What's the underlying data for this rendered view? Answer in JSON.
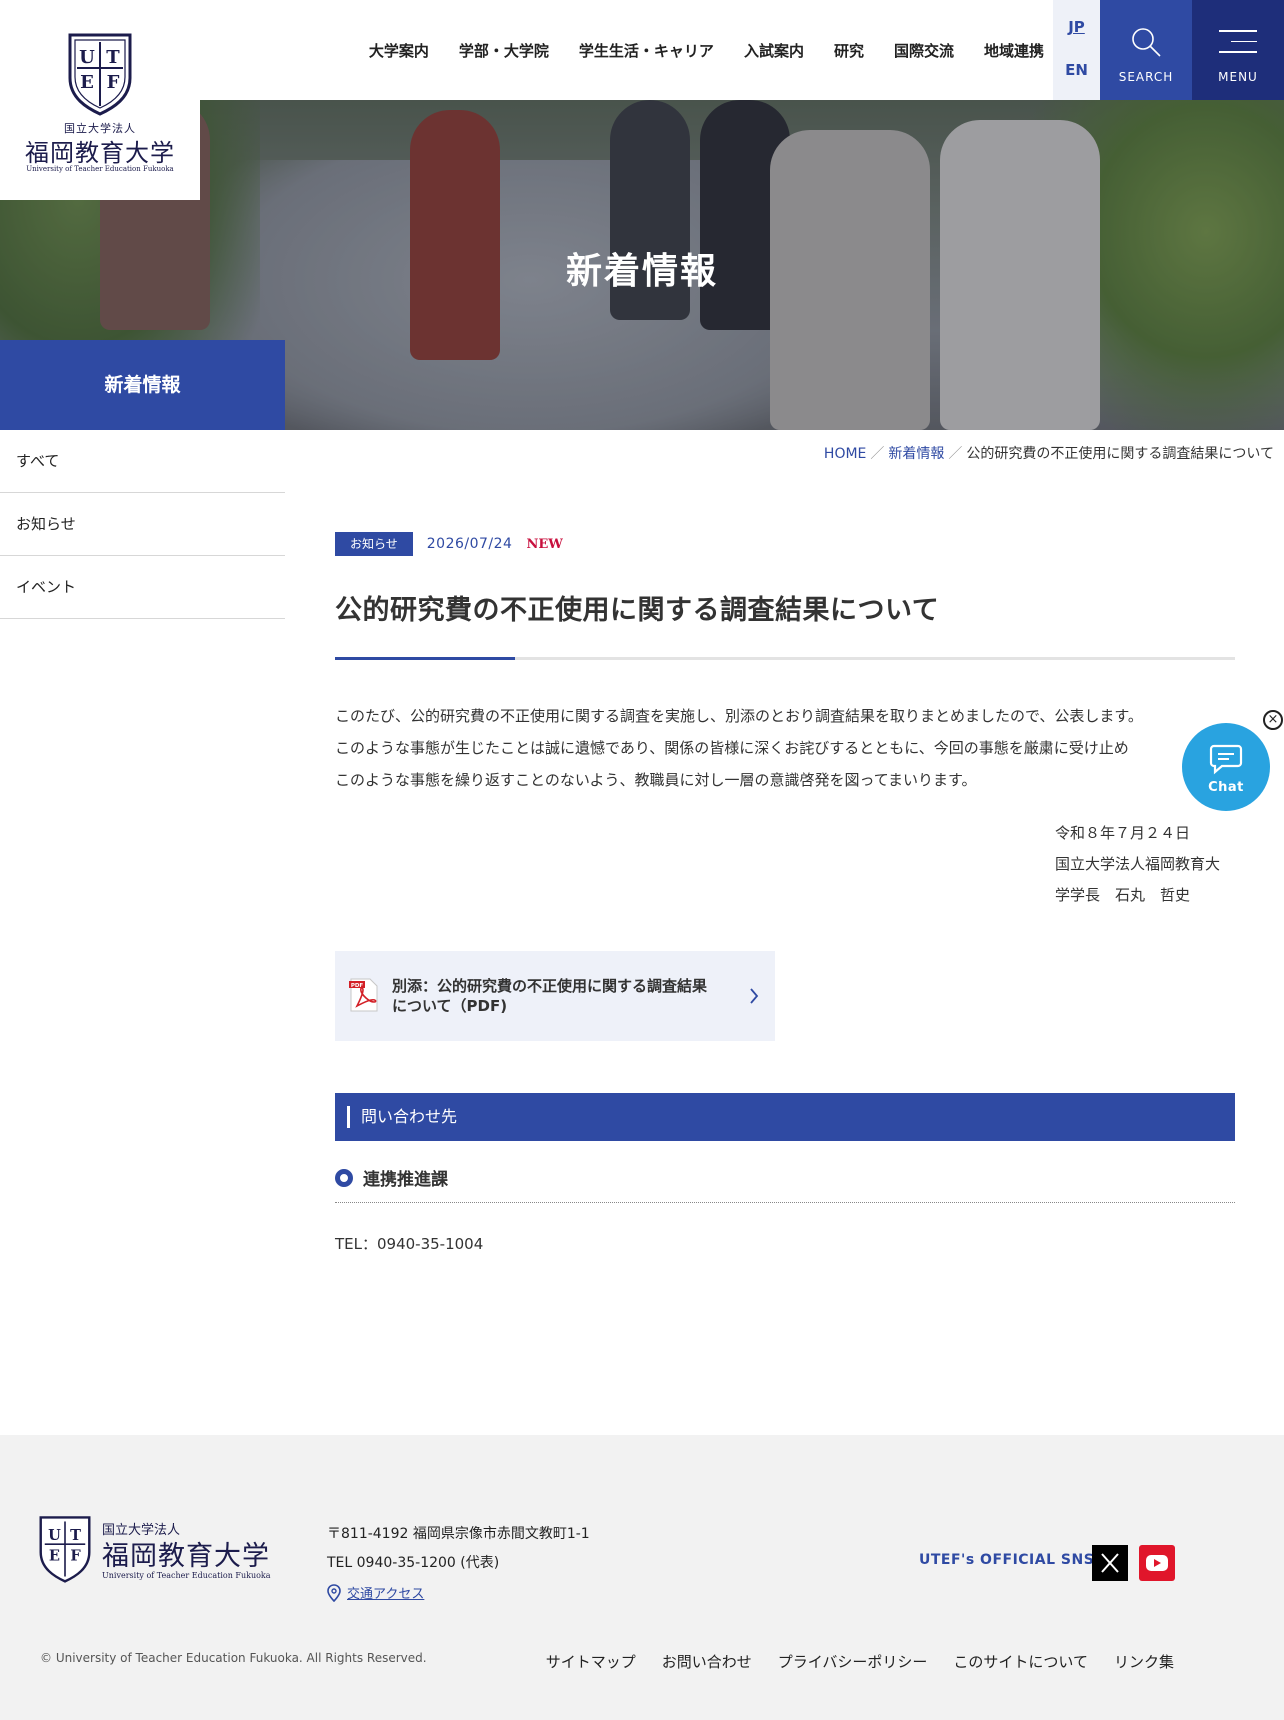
{
  "header": {
    "logo": {
      "sub": "国立大学法人",
      "name": "福岡教育大学",
      "en": "University of Teacher Education Fukuoka",
      "crest_letters": [
        "U",
        "T",
        "E",
        "F"
      ]
    },
    "nav": [
      "大学案内",
      "学部・大学院",
      "学生生活・キャリア",
      "入試案内",
      "研究",
      "国際交流",
      "地域連携"
    ],
    "lang": {
      "jp": "JP",
      "en": "EN"
    },
    "search_label": "SEARCH",
    "menu_label": "MENU"
  },
  "hero": {
    "title": "新着情報"
  },
  "sidebar": {
    "heading": "新着情報",
    "items": [
      "すべて",
      "お知らせ",
      "イベント"
    ]
  },
  "breadcrumb": {
    "home": "HOME",
    "section": "新着情報",
    "current": "公的研究費の不正使用に関する調査結果について",
    "separator": "／"
  },
  "article": {
    "category": "お知らせ",
    "date": "2026/07/24",
    "new_badge": "NEW",
    "title": "公的研究費の不正使用に関する調査結果について",
    "paragraphs": [
      "このたび、公的研究費の不正使用に関する調査を実施し、別添のとおり調査結果を取りまとめましたので、公表します。",
      "このような事態が生じたことは誠に遺憾であり、関係の皆様に深くお詫びするとともに、今回の事態を厳粛に受け止め",
      "このような事態を繰り返すことのないよう、教職員に対し一層の意識啓発を図ってまいります。"
    ],
    "signature": [
      "令和８年７月２４日",
      "国立大学法人福岡教育大",
      "学学長　石丸　哲史"
    ],
    "attachment": {
      "label_line1": "別添：公的研究費の不正使用に関する調査結果",
      "label_line2": "について（PDF)",
      "icon": "pdf-icon"
    },
    "contact": {
      "heading": "問い合わせ先",
      "department": "連携推進課",
      "tel": "TEL：0940-35-1004"
    }
  },
  "chat": {
    "label": "Chat",
    "close": "×"
  },
  "footer": {
    "logo": {
      "sub": "国立大学法人",
      "name": "福岡教育大学",
      "en": "University of Teacher Education Fukuoka"
    },
    "address": "〒811-4192 福岡県宗像市赤間文教町1-1",
    "tel": "TEL 0940-35-1200 (代表)",
    "access": "交通アクセス",
    "sns_label": "UTEF's OFFICIAL SNS",
    "copyright": "© University of Teacher Education Fukuoka. All Rights Reserved.",
    "links": [
      "サイトマップ",
      "お問い合わせ",
      "プライバシーポリシー",
      "このサイトについて",
      "リンク集"
    ]
  },
  "colors": {
    "primary": "#2f4aa3",
    "navy": "#1e2e7a",
    "chat": "#29a3e0",
    "new_badge": "#c8103e"
  }
}
